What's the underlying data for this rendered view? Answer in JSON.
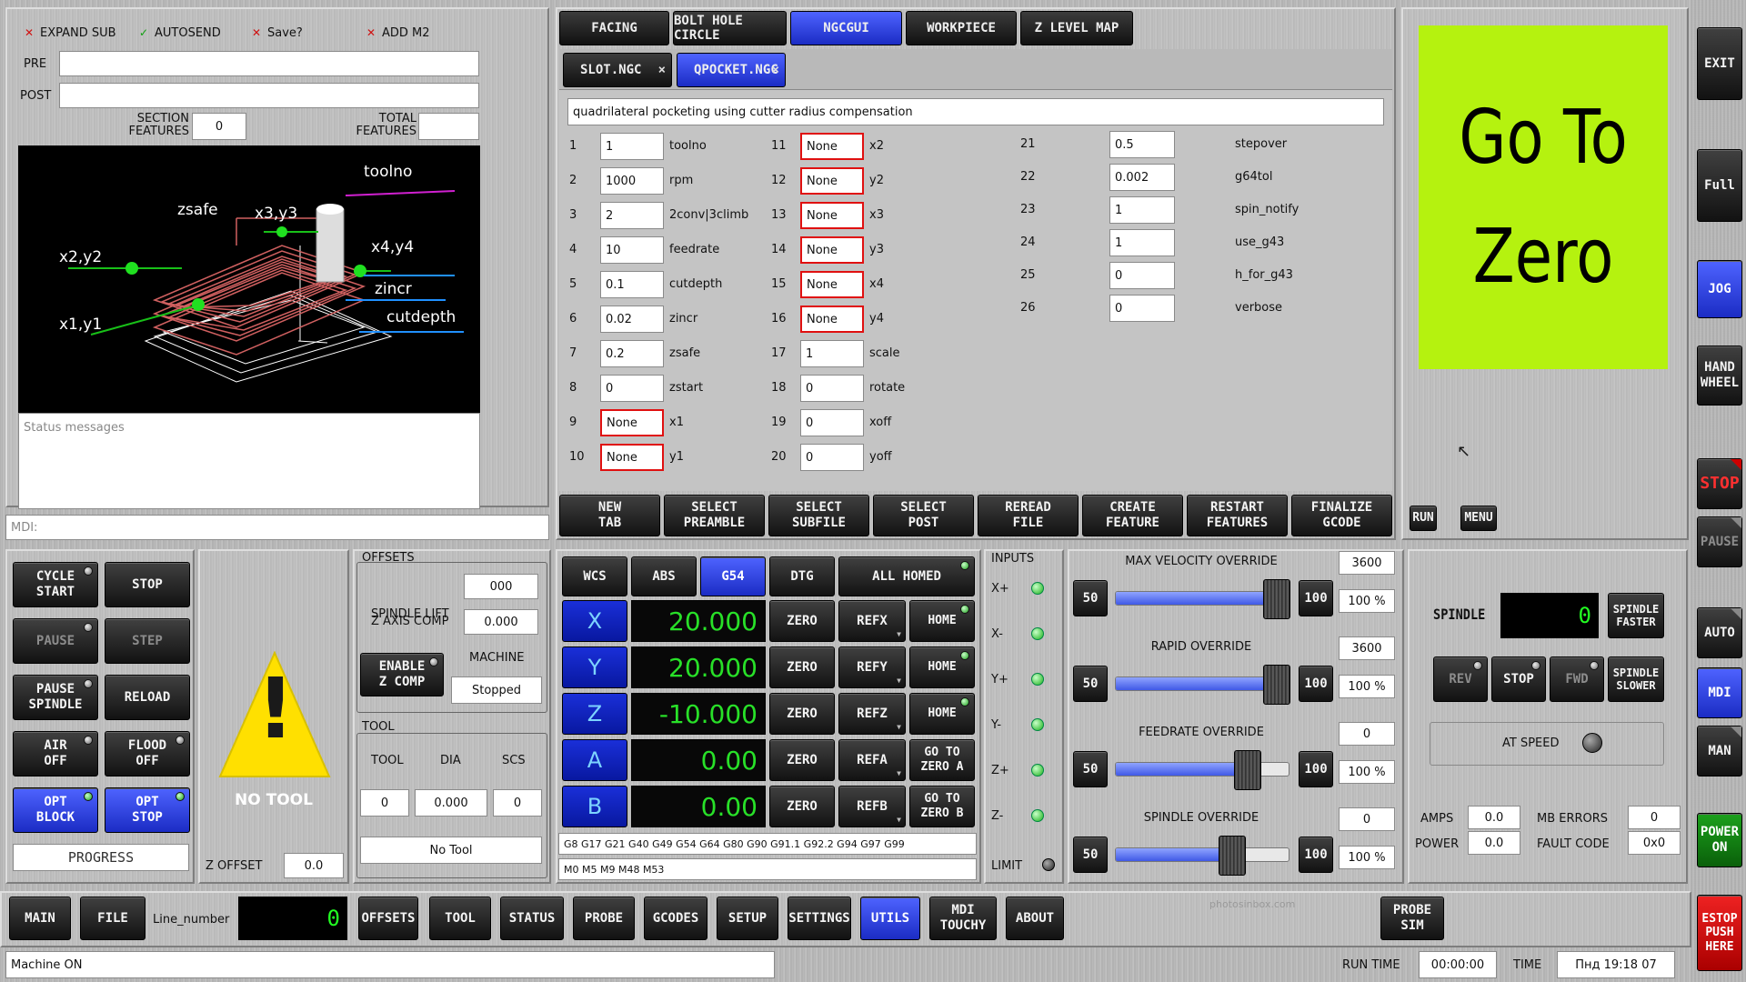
{
  "top_left": {
    "check_expand_sub": "EXPAND SUB",
    "check_autosend": "AUTOSEND",
    "check_save": "Save?",
    "check_add_m2": "ADD M2",
    "pre_label": "PRE",
    "post_label": "POST",
    "section_features_label": "SECTION\nFEATURES",
    "section_features_value": "0",
    "total_features_label": "TOTAL\nFEATURES",
    "total_features_value": "",
    "status_placeholder": "Status messages",
    "mdi_placeholder": "MDI:"
  },
  "preview_labels": {
    "toolno": "toolno",
    "zsafe": "zsafe",
    "x3y3": "x3,y3",
    "x2y2": "x2,y2",
    "x4y4": "x4,y4",
    "zincr": "zincr",
    "x1y1": "x1,y1",
    "cutdepth": "cutdepth"
  },
  "top_tabs": [
    "FACING",
    "BOLT HOLE CIRCLE",
    "NGCGUI",
    "WORKPIECE",
    "Z LEVEL MAP"
  ],
  "file_tabs": [
    "SLOT.NGC",
    "QPOCKET.NGC"
  ],
  "file_tab_close": "×",
  "description": "quadrilateral pocketing using cutter radius compensation",
  "params_col1": [
    {
      "n": "1",
      "v": "1",
      "name": "toolno"
    },
    {
      "n": "2",
      "v": "1000",
      "name": "rpm"
    },
    {
      "n": "3",
      "v": "2",
      "name": "2conv|3climb"
    },
    {
      "n": "4",
      "v": "10",
      "name": "feedrate"
    },
    {
      "n": "5",
      "v": "0.1",
      "name": "cutdepth"
    },
    {
      "n": "6",
      "v": "0.02",
      "name": "zincr"
    },
    {
      "n": "7",
      "v": "0.2",
      "name": "zsafe"
    },
    {
      "n": "8",
      "v": "0",
      "name": "zstart"
    },
    {
      "n": "9",
      "v": "None",
      "name": "x1"
    },
    {
      "n": "10",
      "v": "None",
      "name": "y1"
    }
  ],
  "params_col2": [
    {
      "n": "11",
      "v": "None",
      "name": "x2"
    },
    {
      "n": "12",
      "v": "None",
      "name": "y2"
    },
    {
      "n": "13",
      "v": "None",
      "name": "x3"
    },
    {
      "n": "14",
      "v": "None",
      "name": "y3"
    },
    {
      "n": "15",
      "v": "None",
      "name": "x4"
    },
    {
      "n": "16",
      "v": "None",
      "name": "y4"
    },
    {
      "n": "17",
      "v": "1",
      "name": "scale"
    },
    {
      "n": "18",
      "v": "0",
      "name": "rotate"
    },
    {
      "n": "19",
      "v": "0",
      "name": "xoff"
    },
    {
      "n": "20",
      "v": "0",
      "name": "yoff"
    }
  ],
  "params_col3": [
    {
      "n": "21",
      "v": "0.5",
      "name": "stepover"
    },
    {
      "n": "22",
      "v": "0.002",
      "name": "g64tol"
    },
    {
      "n": "23",
      "v": "1",
      "name": "spin_notify"
    },
    {
      "n": "24",
      "v": "1",
      "name": "use_g43"
    },
    {
      "n": "25",
      "v": "0",
      "name": "h_for_g43"
    },
    {
      "n": "26",
      "v": "0",
      "name": "verbose"
    }
  ],
  "ngcgui_buttons": [
    "NEW\nTAB",
    "SELECT\nPREAMBLE",
    "SELECT\nSUBFILE",
    "SELECT\nPOST",
    "REREAD\nFILE",
    "CREATE\nFEATURE",
    "RESTART\nFEATURES",
    "FINALIZE\nGCODE"
  ],
  "go_to_zero": "Go To\nZero",
  "run_label": "RUN",
  "menu_label": "MENU",
  "right_rail": [
    "EXIT",
    "Full",
    "JOG",
    "HAND\nWHEEL",
    "STOP",
    "PAUSE",
    "AUTO",
    "MDI",
    "MAN",
    "POWER\nON",
    "ESTOP\nPUSH\nHERE"
  ],
  "control_buttons": {
    "cycle_start": "CYCLE\nSTART",
    "stop": "STOP",
    "pause": "PAUSE",
    "step": "STEP",
    "pause_spindle": "PAUSE\nSPINDLE",
    "reload": "RELOAD",
    "air_off": "AIR\nOFF",
    "flood_off": "FLOOD\nOFF",
    "opt_block": "OPT\nBLOCK",
    "opt_stop": "OPT\nSTOP",
    "progress": "PROGRESS"
  },
  "tool_warning": {
    "text": "NO TOOL",
    "glyph": "!",
    "z_offset_label": "Z OFFSET",
    "z_offset_value": "0.0"
  },
  "offsets": {
    "title": "OFFSETS",
    "spindle_lift_label": "SPINDLE LIFT",
    "spindle_lift_value": "000",
    "z_axis_comp_label": "Z AXIS COMP",
    "z_axis_comp_value": "0.000",
    "enable_z_comp": "ENABLE\nZ COMP",
    "machine_label": "MACHINE",
    "machine_value": "Stopped"
  },
  "tool": {
    "title": "TOOL",
    "col_tool": "TOOL",
    "col_dia": "DIA",
    "col_scs": "SCS",
    "tool_value": "0",
    "dia_value": "0.000",
    "scs_value": "0",
    "tool_name": "No Tool"
  },
  "dro": {
    "wcs": "WCS",
    "abs": "ABS",
    "g54": "G54",
    "dtg": "DTG",
    "all_homed": "ALL HOMED",
    "axes": [
      {
        "name": "X",
        "value": "20.000",
        "zero": "ZERO",
        "ref": "REFX",
        "home": "HOME"
      },
      {
        "name": "Y",
        "value": "20.000",
        "zero": "ZERO",
        "ref": "REFY",
        "home": "HOME"
      },
      {
        "name": "Z",
        "value": "-10.000",
        "zero": "ZERO",
        "ref": "REFZ",
        "home": "HOME"
      },
      {
        "name": "A",
        "value": "0.00",
        "zero": "ZERO",
        "ref": "REFA",
        "home": "GO TO\nZERO  A"
      },
      {
        "name": "B",
        "value": "0.00",
        "zero": "ZERO",
        "ref": "REFB",
        "home": "GO TO\nZERO B"
      }
    ],
    "gcodes": "G8 G17 G21 G40 G49 G54 G64 G80 G90 G91.1 G92.2 G94 G97 G99",
    "mcodes": "M0 M5 M9 M48 M53"
  },
  "inputs": {
    "title": "INPUTS",
    "labels": [
      "X+",
      "X-",
      "Y+",
      "Y-",
      "Z+",
      "Z-"
    ],
    "limit": "LIMIT"
  },
  "overrides": [
    {
      "title": "MAX VELOCITY OVERRIDE",
      "value": "3600",
      "pct": "100 %",
      "fill": 1.0,
      "b50": "50",
      "b100": "100"
    },
    {
      "title": "RAPID OVERRIDE",
      "value": "3600",
      "pct": "100 %",
      "fill": 1.0,
      "b50": "50",
      "b100": "100"
    },
    {
      "title": "FEEDRATE OVERRIDE",
      "value": "0",
      "pct": "100 %",
      "fill": 0.8,
      "b50": "50",
      "b100": "100"
    },
    {
      "title": "SPINDLE OVERRIDE",
      "value": "0",
      "pct": "100 %",
      "fill": 0.7,
      "b50": "50",
      "b100": "100"
    }
  ],
  "spindle": {
    "label": "SPINDLE",
    "rpm": "0",
    "faster": "SPINDLE\nFASTER",
    "slower": "SPINDLE\nSLOWER",
    "rev": "REV",
    "stop": "STOP",
    "fwd": "FWD",
    "at_speed": "AT SPEED",
    "amps_label": "AMPS",
    "amps": "0.0",
    "power_label": "POWER",
    "power": "0.0",
    "mb_errors_label": "MB ERRORS",
    "mb_errors": "0",
    "fault_label": "FAULT CODE",
    "fault": "0x0"
  },
  "bottom_tabs": {
    "main": "MAIN",
    "file": "FILE",
    "line_number_label": "Line_number",
    "line_number": "0",
    "offsets": "OFFSETS",
    "tool": "TOOL",
    "status": "STATUS",
    "probe": "PROBE",
    "gcodes": "GCODES",
    "setup": "SETUP",
    "settings": "SETTINGS",
    "utils": "UTILS",
    "mdi_touchy": "MDI\nTOUCHY",
    "about": "ABOUT",
    "probe_sim": "PROBE\nSIM",
    "watermark": "photosinbox.com"
  },
  "status_bar": {
    "message": "Machine ON",
    "run_time_label": "RUN TIME",
    "run_time": "00:00:00",
    "time_label": "TIME",
    "time": "Пнд 19:18 07"
  },
  "colors": {
    "accent_blue": "#2a3cf0",
    "go_to_zero_bg": "#b5f20f",
    "led_green": "#1ab01a",
    "dro_green": "#28e028",
    "invalid_red": "#e01010"
  }
}
